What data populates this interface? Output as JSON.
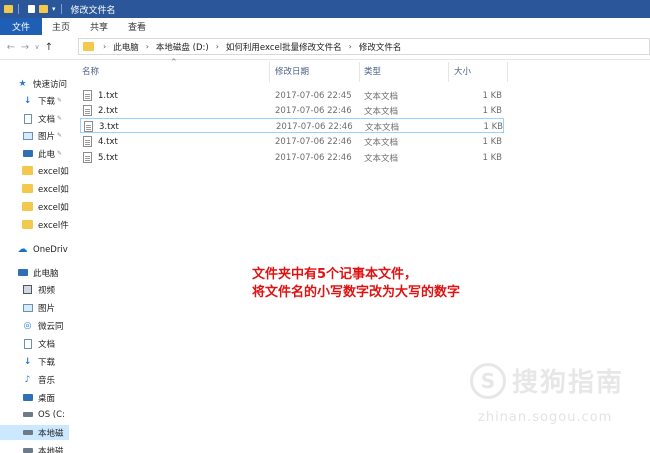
{
  "window": {
    "title": "修改文件名"
  },
  "ribbon": {
    "tabs": [
      "文件",
      "主页",
      "共享",
      "查看"
    ]
  },
  "breadcrumb": [
    "此电脑",
    "本地磁盘 (D:)",
    "如何利用excel批量修改文件名",
    "修改文件名"
  ],
  "sidebar": {
    "items": [
      {
        "label": "快速访问",
        "icon": "star-icon"
      },
      {
        "label": "下载",
        "icon": "download-icon",
        "pinned": true
      },
      {
        "label": "文档",
        "icon": "document-icon",
        "pinned": true
      },
      {
        "label": "图片",
        "icon": "picture-icon",
        "pinned": true
      },
      {
        "label": "此电",
        "icon": "computer-icon",
        "pinned": true
      },
      {
        "label": "excel如",
        "icon": "folder-icon"
      },
      {
        "label": "excel如",
        "icon": "folder-icon"
      },
      {
        "label": "excel如",
        "icon": "folder-icon"
      },
      {
        "label": "excel件",
        "icon": "folder-icon"
      },
      {
        "label": "OneDriv",
        "icon": "cloud-icon"
      },
      {
        "label": "此电脑",
        "icon": "computer-icon"
      },
      {
        "label": "视频",
        "icon": "video-icon"
      },
      {
        "label": "图片",
        "icon": "picture-icon"
      },
      {
        "label": "微云同",
        "icon": "cloud-sync-icon"
      },
      {
        "label": "文档",
        "icon": "document-icon"
      },
      {
        "label": "下载",
        "icon": "download-icon"
      },
      {
        "label": "音乐",
        "icon": "music-icon"
      },
      {
        "label": "桌面",
        "icon": "desktop-icon"
      },
      {
        "label": "OS (C:",
        "icon": "drive-icon"
      },
      {
        "label": "本地磁",
        "icon": "drive-icon",
        "selected": true
      },
      {
        "label": "本地磁",
        "icon": "drive-icon"
      }
    ]
  },
  "columns": {
    "name": "名称",
    "date": "修改日期",
    "type": "类型",
    "size": "大小"
  },
  "files": [
    {
      "name": "1.txt",
      "date": "2017-07-06 22:45",
      "type": "文本文档",
      "size": "1 KB"
    },
    {
      "name": "2.txt",
      "date": "2017-07-06 22:46",
      "type": "文本文档",
      "size": "1 KB"
    },
    {
      "name": "3.txt",
      "date": "2017-07-06 22:46",
      "type": "文本文档",
      "size": "1 KB",
      "selected": true
    },
    {
      "name": "4.txt",
      "date": "2017-07-06 22:46",
      "type": "文本文档",
      "size": "1 KB"
    },
    {
      "name": "5.txt",
      "date": "2017-07-06 22:46",
      "type": "文本文档",
      "size": "1 KB"
    }
  ],
  "annotation": {
    "line1": "文件夹中有5个记事本文件，",
    "line2": "将文件名的小写数字改为大写的数字"
  },
  "watermark": {
    "brand": "搜狗指南",
    "url": "zhinan.sogou.com"
  },
  "colors": {
    "titlebar": "#2b579a",
    "file_tab": "#1e5eb4",
    "annotation": "#e01212",
    "selection": "#cce8ff"
  }
}
